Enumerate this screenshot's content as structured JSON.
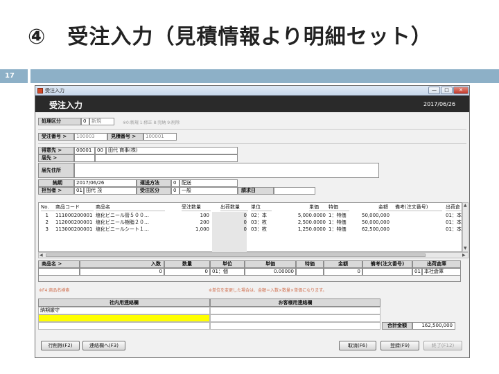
{
  "slide": {
    "title": "④　受注入力（見積情報より明細セット）",
    "number": "17"
  },
  "window": {
    "title": "受注入力",
    "min": "—",
    "max": "□",
    "close": "✕",
    "header_title": "受注入力",
    "date": "2017/06/26"
  },
  "form": {
    "process_label": "処理区分",
    "process_code": "0",
    "process_value": "新規",
    "process_note": "※0:新規 1:修正 8:完納 9:削除",
    "order_no_label": "受注番号 >",
    "order_no": "100003",
    "quote_no_label": "見積番号 >",
    "quote_no": "100001",
    "customer_label": "得意先 >",
    "customer_code": "00001",
    "customer_branch": "00",
    "customer_name": "田代 商事(株)",
    "ship_label": "届先 >",
    "ship_address_label": "届先住所",
    "delivery_label": "納期",
    "delivery_date": "2017/06/26",
    "shipping_method_label": "運送方法",
    "shipping_method_code": "0",
    "shipping_method_value": "配送",
    "staff_label": "担当者 >",
    "staff_code": "01",
    "staff_name": "田代 茂",
    "order_type_label": "受注区分",
    "order_type_code": "0",
    "order_type_value": "一般",
    "invoice_date_label": "請求日"
  },
  "table": {
    "columns": [
      "No.",
      "商品コード",
      "商品名",
      "受注数量",
      "出荷数量",
      "単位",
      "単価",
      "特価",
      "金額",
      "備考(注文番号)",
      "出荷倉"
    ],
    "rows": [
      {
        "no": "1",
        "code": "111000200001",
        "name": "塩化ビニール管５００…",
        "qty": "100",
        "ship_qty": "0",
        "unit": "02：本",
        "price": "5,000.0000",
        "special": "1：特価",
        "amount": "50,000,000",
        "remark": "",
        "warehouse": "01：本"
      },
      {
        "no": "2",
        "code": "112000200001",
        "name": "塩化ビニール樹脂２０…",
        "qty": "200",
        "ship_qty": "0",
        "unit": "03：枚",
        "price": "2,500.0000",
        "special": "1：特価",
        "amount": "50,000,000",
        "remark": "",
        "warehouse": "01：本"
      },
      {
        "no": "3",
        "code": "113000200001",
        "name": "塩化ビニールシート１…",
        "qty": "1,000",
        "ship_qty": "0",
        "unit": "03：枚",
        "price": "1,250.0000",
        "special": "1：特価",
        "amount": "62,500,000",
        "remark": "",
        "warehouse": "01：本"
      }
    ]
  },
  "detail": {
    "headers": [
      "商品名 >",
      "入数",
      "数量",
      "単位",
      "単価",
      "特価",
      "金額",
      "備考(注文番号)",
      "出荷倉庫"
    ],
    "irisu": "0",
    "qty": "0",
    "unit": "01：個",
    "price": "0.00000",
    "amount": "0",
    "warehouse_code": "01",
    "warehouse_name": "本社倉庫",
    "note_left": "※F4:商品名検索",
    "note_right": "※単位を変更した場合は、金額＝入数×数量×単価になります。"
  },
  "memo": {
    "internal_label": "社内用連絡欄",
    "customer_label": "お客様用連絡欄",
    "internal_line1": "納期厳守"
  },
  "totals": {
    "label": "合計金額",
    "value": "162,500,000"
  },
  "buttons": {
    "delete_row": "行削除(F2)",
    "memo": "連絡欄へ(F3)",
    "cancel": "取消(F6)",
    "register": "登録(F9)",
    "end": "終了(F12)"
  },
  "colors": {
    "header_bg": "#2a2a2a",
    "slide_bar": "#8db0c7",
    "highlight": "#ffff00"
  }
}
